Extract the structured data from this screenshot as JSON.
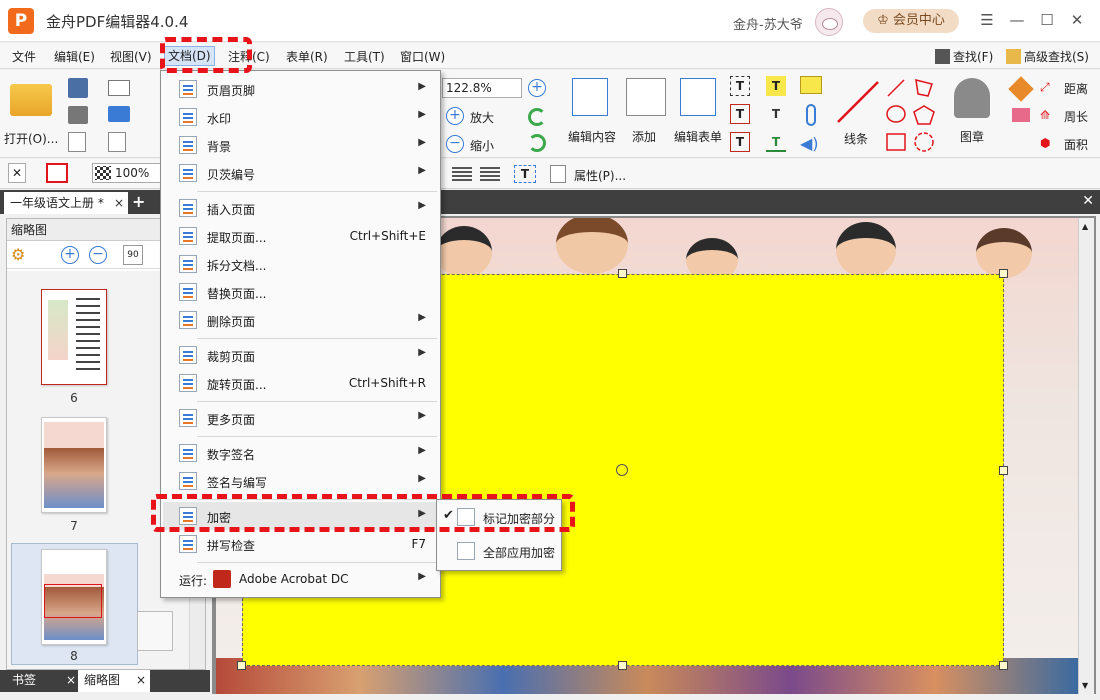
{
  "app": {
    "logo_letter": "P",
    "title": "金舟PDF编辑器4.0.4",
    "user_name": "金舟-苏大爷",
    "vip_label": "会员中心",
    "window_controls": [
      "☰",
      "—",
      "☐",
      "✕"
    ]
  },
  "menubar": {
    "items": [
      "文件",
      "编辑(E)",
      "视图(V)",
      "文档(D)",
      "注释(C)",
      "表单(R)",
      "工具(T)",
      "窗口(W)"
    ],
    "active": "文档(D)",
    "find_label": "查找(F)",
    "adv_find_label": "高级查找(S)"
  },
  "toolbar": {
    "open_label": "打开(O)...",
    "zoom_value": "122.8%",
    "zoom_in_label": "放大",
    "zoom_out_label": "缩小",
    "edit_content_label": "编辑内容",
    "add_label": "添加",
    "edit_form_label": "编辑表单",
    "line_label": "线条",
    "stamp_label": "图章",
    "distance_label": "距离",
    "perimeter_label": "周长",
    "area_label": "面积"
  },
  "propbar": {
    "opacity_value": "100%",
    "properties_label": "属性(P)..."
  },
  "tabs": {
    "doc_tab": "一年级语文上册 *",
    "close_glyph": "×",
    "add_glyph": "+"
  },
  "left_panel": {
    "header": "缩略图",
    "thumbs": [
      {
        "num": "6"
      },
      {
        "num": "7"
      },
      {
        "num": "8"
      }
    ],
    "bottom_tabs": [
      "书签",
      "缩略图"
    ]
  },
  "doc_menu": {
    "items": [
      {
        "label": "页眉页脚",
        "shortcut": "",
        "submenu": true
      },
      {
        "label": "水印",
        "shortcut": "",
        "submenu": true
      },
      {
        "label": "背景",
        "shortcut": "",
        "submenu": true
      },
      {
        "label": "贝茨编号",
        "shortcut": "",
        "submenu": true
      },
      {
        "label": "插入页面",
        "shortcut": "",
        "submenu": true
      },
      {
        "label": "提取页面...",
        "shortcut": "Ctrl+Shift+E",
        "submenu": false
      },
      {
        "label": "拆分文档...",
        "shortcut": "",
        "submenu": false
      },
      {
        "label": "替换页面...",
        "shortcut": "",
        "submenu": false
      },
      {
        "label": "删除页面",
        "shortcut": "",
        "submenu": true
      },
      {
        "label": "裁剪页面",
        "shortcut": "",
        "submenu": true
      },
      {
        "label": "旋转页面...",
        "shortcut": "Ctrl+Shift+R",
        "submenu": false
      },
      {
        "label": "更多页面",
        "shortcut": "",
        "submenu": true
      },
      {
        "label": "数字签名",
        "shortcut": "",
        "submenu": true
      },
      {
        "label": "签名与编写",
        "shortcut": "",
        "submenu": true
      },
      {
        "label": "加密",
        "shortcut": "",
        "submenu": true
      },
      {
        "label": "拼写检查",
        "shortcut": "F7",
        "submenu": false
      }
    ],
    "run_label": "运行:",
    "run_app": "Adobe Acrobat DC"
  },
  "encrypt_submenu": {
    "items": [
      "标记加密部分",
      "全部应用加密"
    ],
    "checked": "标记加密部分"
  },
  "colors": {
    "accent": "#3a7bd5",
    "annotation_red": "#e8141a",
    "redaction_yellow": "#ffff00",
    "logo_orange": "#f26a1b"
  }
}
